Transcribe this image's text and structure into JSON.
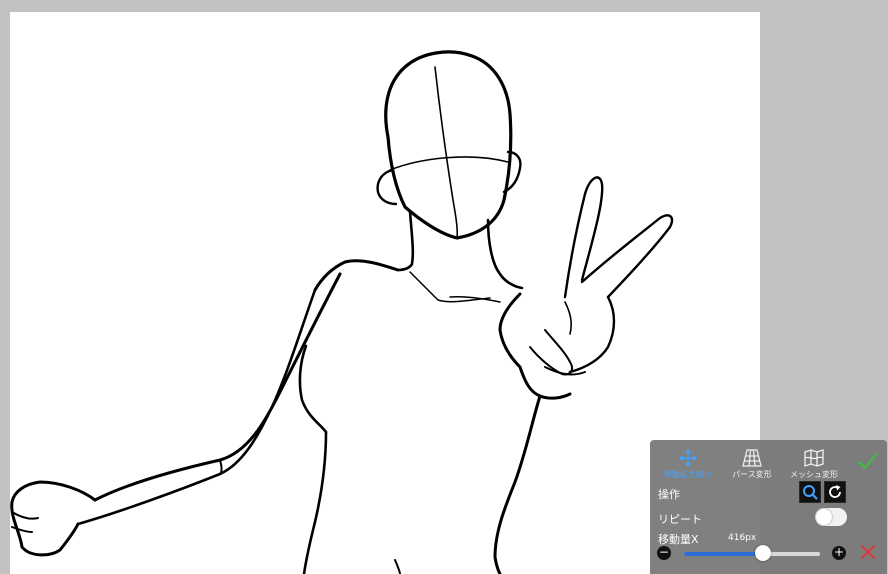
{
  "tools": {
    "move_label": "移動拡大縮小",
    "perspective_label": "パース変形",
    "mesh_label": "メッシュ変形"
  },
  "panel": {
    "operation_label": "操作",
    "repeat_label": "リピート",
    "amount_label": "移動量X",
    "amount_value": "416px",
    "slider_value": 0.58,
    "repeat_on": false
  },
  "colors": {
    "active_tool": "#3ea4ff",
    "confirm": "#3fbf3f",
    "cancel": "#e03c3c",
    "slider_fill": "#2c6cd6"
  },
  "icons": {
    "move": "move-arrows-icon",
    "perspective": "perspective-grid-icon",
    "mesh": "mesh-map-icon",
    "zoom": "search-icon",
    "rotate": "rotate-icon",
    "confirm": "checkmark-icon",
    "cancel": "close-icon"
  }
}
